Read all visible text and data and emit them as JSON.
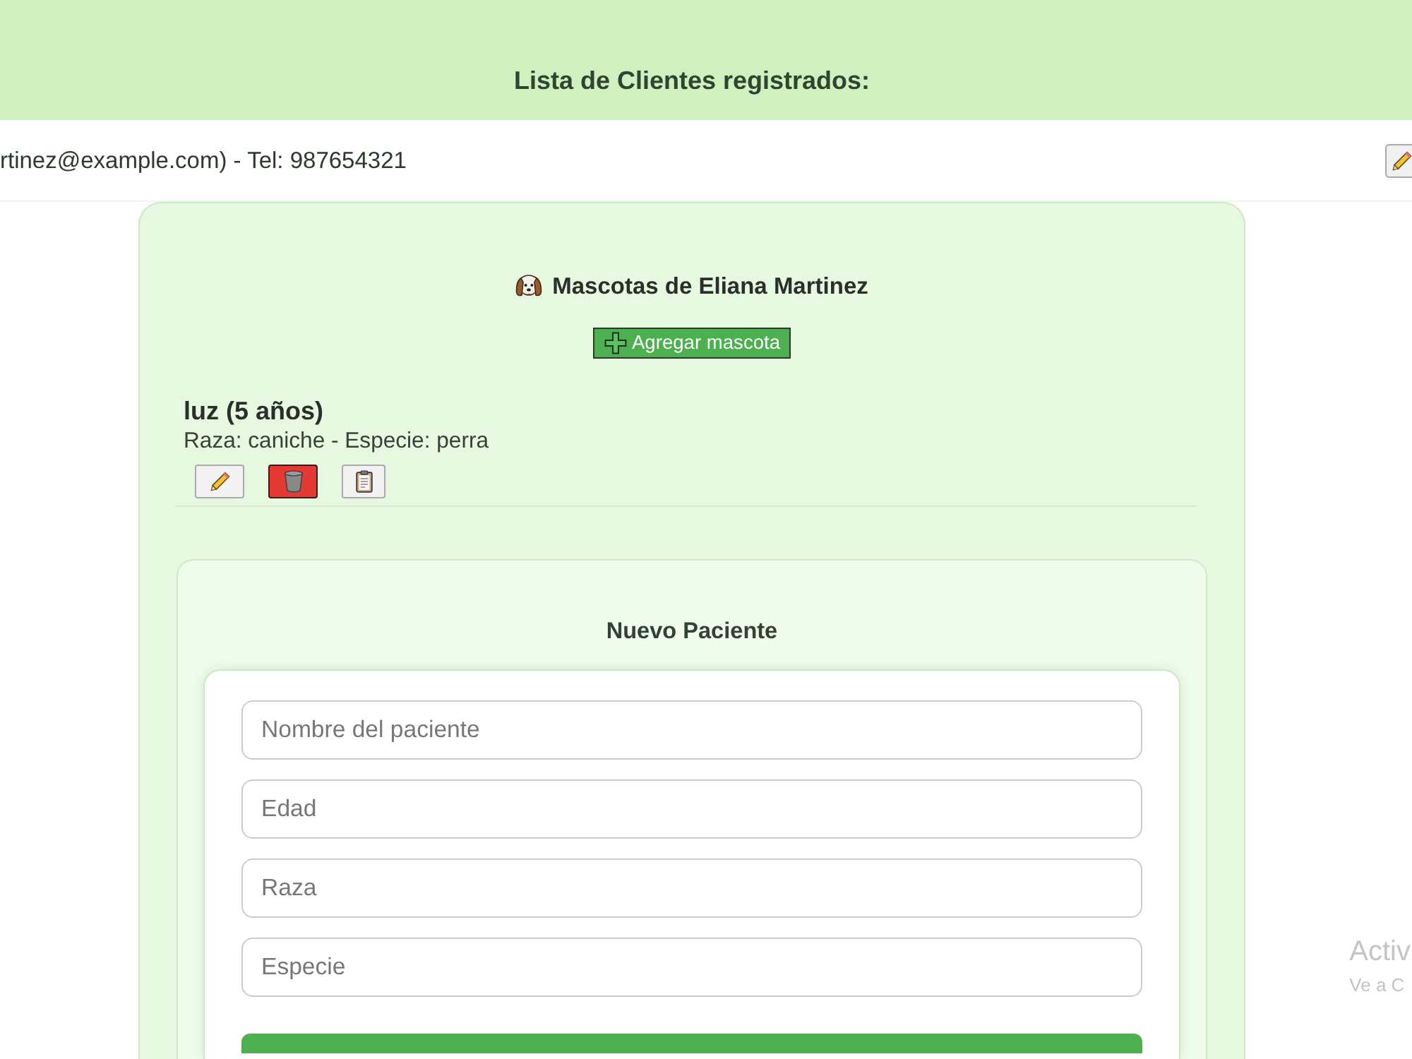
{
  "header": {
    "title": "Lista de Clientes registrados:"
  },
  "client": {
    "text": "rtinez@example.com) - Tel: 987654321",
    "actions": [
      {
        "kind": "edit"
      }
    ]
  },
  "pets_panel": {
    "title": "Mascotas de Eliana Martinez",
    "add_button": "Agregar mascota",
    "pets": [
      {
        "name_line": "luz (5 años)",
        "details": "Raza: caniche - Especie: perra",
        "actions": [
          {
            "kind": "edit"
          },
          {
            "kind": "delete"
          },
          {
            "kind": "record"
          }
        ]
      }
    ]
  },
  "new_patient_form": {
    "title": "Nuevo Paciente",
    "fields": [
      {
        "placeholder": "Nombre del paciente"
      },
      {
        "placeholder": "Edad"
      },
      {
        "placeholder": "Raza"
      },
      {
        "placeholder": "Especie"
      }
    ]
  },
  "system_notice": {
    "line_1": "Activ",
    "line_2": "Ve a C"
  }
}
